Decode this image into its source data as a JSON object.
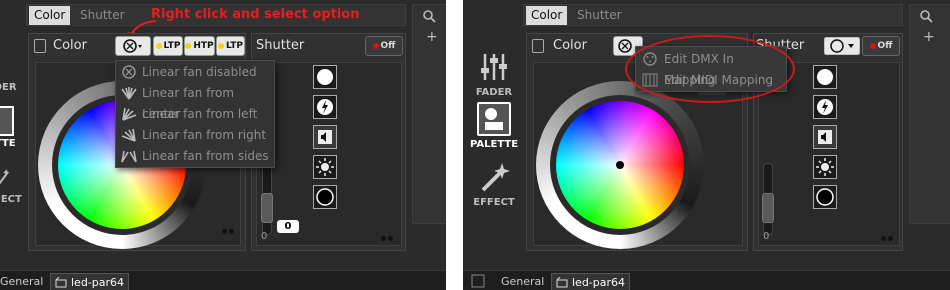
{
  "annotation": "Right click and select option",
  "tabs": [
    "Color",
    "Shutter"
  ],
  "rail": {
    "fader": "FADER",
    "palette": "PALETTE",
    "effect": "EFFECT",
    "fader_partial": "ADER",
    "palette_partial": "ETTE",
    "effect_partial": "FECT"
  },
  "color_panel": {
    "title": "Color",
    "ltp1": "LTP",
    "htp": "HTP",
    "ltp2": "LTP"
  },
  "shutter_panel": {
    "title": "Shutter",
    "off": "Off",
    "fader_zero": "0",
    "value": "0"
  },
  "fan_menu": [
    "Linear fan disabled",
    "Linear fan from center",
    "Linear fan from left",
    "Linear fan from right",
    "Linear fan from sides"
  ],
  "context_menu": [
    "Edit DMX In Mapping",
    "Edit MIDI Mapping"
  ],
  "bottom_tabs": {
    "general": "General",
    "fixture": "led-par64"
  },
  "colors": {
    "annotation": "#e22020",
    "accent_yellow": "#f0d020",
    "off_red": "#d01818"
  }
}
